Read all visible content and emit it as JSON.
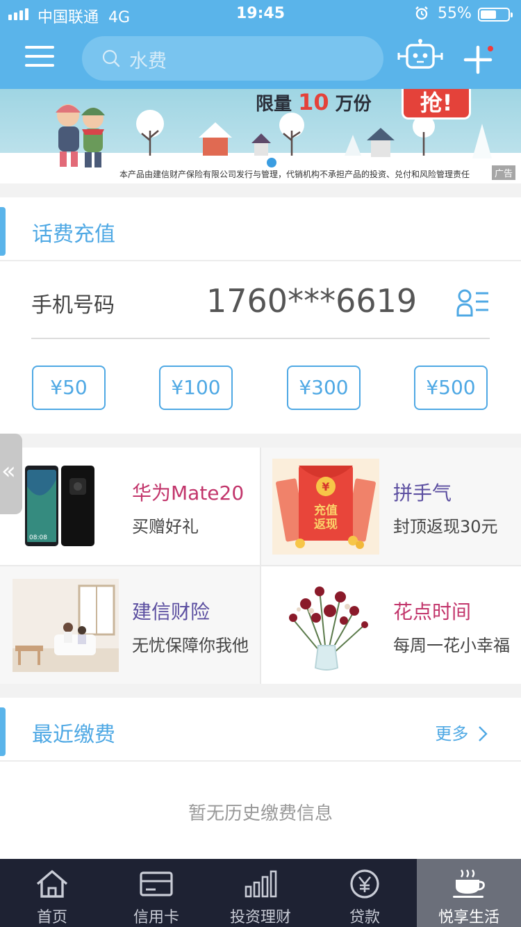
{
  "status_bar": {
    "carrier": "中国联通",
    "network": "4G",
    "time": "19:45",
    "battery": "55%"
  },
  "header": {
    "search_placeholder": "水费"
  },
  "banner": {
    "promo_prefix": "限量",
    "promo_number": "10",
    "promo_suffix": "万份",
    "grab_label": "抢!",
    "disclaimer": "本产品由建信财产保险有限公司发行与管理，代销机构不承担产品的投资、兑付和风险管理责任",
    "ad_tag": "广告"
  },
  "recharge": {
    "section_title": "话费充值",
    "phone_label": "手机号码",
    "phone_number": "1760***6619",
    "amounts": [
      "¥50",
      "¥100",
      "¥300",
      "¥500"
    ]
  },
  "promos": [
    {
      "title": "华为Mate20",
      "subtitle": "买赠好礼",
      "title_color": "#c2356b"
    },
    {
      "title": "拼手气",
      "subtitle": "封顶返现30元",
      "title_color": "#5b4ea0"
    },
    {
      "title": "建信财险",
      "subtitle": "无忧保障你我他",
      "title_color": "#5b4ea0"
    },
    {
      "title": "花点时间",
      "subtitle": "每周一花小幸福",
      "title_color": "#c2356b"
    }
  ],
  "promo_thumbs": {
    "red_packet_line1": "充值",
    "red_packet_line2": "返现",
    "phone_time": "08:08"
  },
  "side_tab": {
    "glyph": "«"
  },
  "recent": {
    "section_title": "最近缴费",
    "more_label": "更多",
    "empty_text": "暂无历史缴费信息"
  },
  "tabs": [
    {
      "label": "首页",
      "icon": "home-icon"
    },
    {
      "label": "信用卡",
      "icon": "credit-card-icon"
    },
    {
      "label": "投资理财",
      "icon": "bar-chart-icon"
    },
    {
      "label": "贷款",
      "icon": "yuan-circle-icon"
    },
    {
      "label": "悦享生活",
      "icon": "coffee-cup-icon",
      "active": true
    }
  ],
  "colors": {
    "header_blue": "#5ab4ea",
    "accent_blue": "#4ea8e4",
    "tabbar_bg": "#1e2233",
    "badge_red": "#f23b3b"
  }
}
